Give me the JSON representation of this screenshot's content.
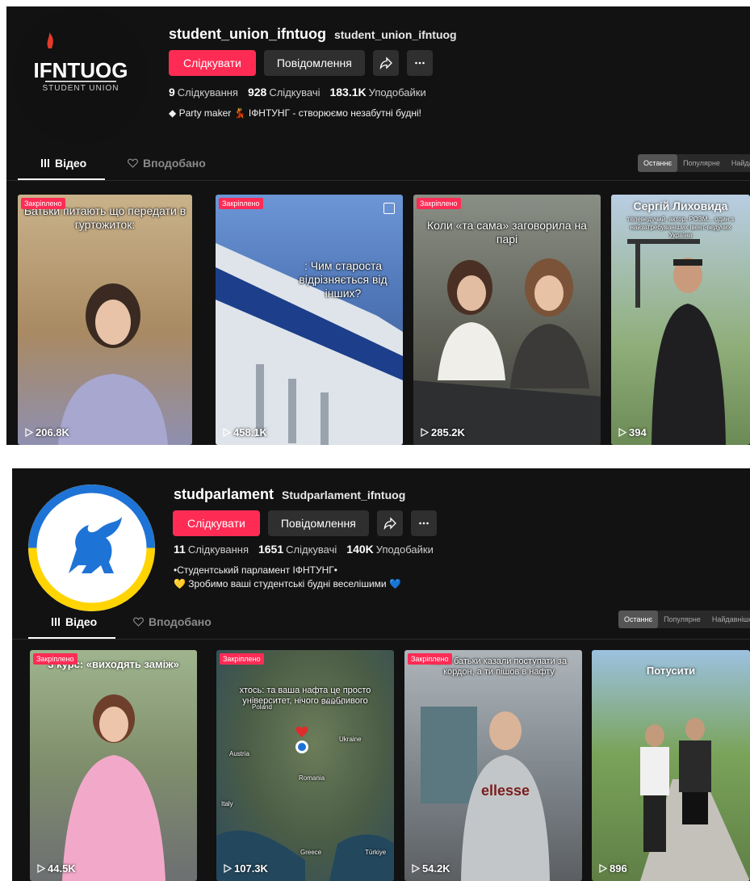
{
  "profile1": {
    "username": "student_union_ifntuog",
    "nickname": "student_union_ifntuog",
    "avatar_text": "IFNTUOG",
    "avatar_subtext": "STUDENT UNION",
    "follow_label": "Слідкувати",
    "message_label": "Повідомлення",
    "stats": [
      {
        "value": "9",
        "label": "Слідкування"
      },
      {
        "value": "928",
        "label": "Слідкувачі"
      },
      {
        "value": "183.1K",
        "label": "Уподобайки"
      }
    ],
    "bio_lines": [
      "◆ Party maker 💃 ІФНТУНГ - створюємо незабутні будні!"
    ],
    "tabs": {
      "videos": "Відео",
      "liked": "Вподобано"
    },
    "sort_options": [
      "Останнє",
      "Популярне",
      "Найдавніше"
    ],
    "videos": [
      {
        "badge": "Закріплено",
        "caption": "Батьки питають що передати в гуртожиток:",
        "views": "206.8K",
        "bg": "#b9a07a"
      },
      {
        "badge": "Закріплено",
        "caption": ": Чим староста відрізняється від інших?",
        "views": "458.1K",
        "bg": "#5e88c8"
      },
      {
        "badge": "Закріплено",
        "caption": "Коли «та сама» заговорила на парі",
        "views": "285.2K",
        "bg": "#6b6b5f"
      },
      {
        "badge": "",
        "title": "Сергій Лиховида",
        "caption": "телеведучий, актор, РОЗМ... один з найзатребуваніших івент-ведучих України",
        "views": "394",
        "bg": "#7f9a6a"
      }
    ]
  },
  "profile2": {
    "username": "studparlament",
    "nickname": "Studparlament_ifntuog",
    "follow_label": "Слідкувати",
    "message_label": "Повідомлення",
    "stats": [
      {
        "value": "11",
        "label": "Слідкування"
      },
      {
        "value": "1651",
        "label": "Слідкувачі"
      },
      {
        "value": "140K",
        "label": "Уподобайки"
      }
    ],
    "bio_lines": [
      "•Студентський парламент ІФНТУНГ•",
      "💛 Зробимо ваші студентські будні веселішими 💙"
    ],
    "tabs": {
      "videos": "Відео",
      "liked": "Вподобано"
    },
    "sort_options": [
      "Останнє",
      "Популярне",
      "Найдавніше"
    ],
    "videos": [
      {
        "badge": "Закріплено",
        "title": "3 курс: «виходять заміж»",
        "views": "44.5K",
        "bg": "#8c9e7c"
      },
      {
        "badge": "Закріплено",
        "caption": "хтось: та ваша нафта це просто університет, нічого особливого",
        "views": "107.3K",
        "bg": "#3e5a4a",
        "map_labels": [
          "Belarus",
          "Poland",
          "Ukraine",
          "Austria",
          "Romania",
          "Italy",
          "Greece",
          "Türkiye"
        ]
      },
      {
        "badge": "Закріплено",
        "caption": "Коли батьки казали поступати за кордон, а ти пішов в нафту",
        "views": "54.2K",
        "bg": "#6d7378"
      },
      {
        "badge": "",
        "title": "Потусити",
        "views": "896",
        "bg": "#7ca55f"
      }
    ]
  }
}
